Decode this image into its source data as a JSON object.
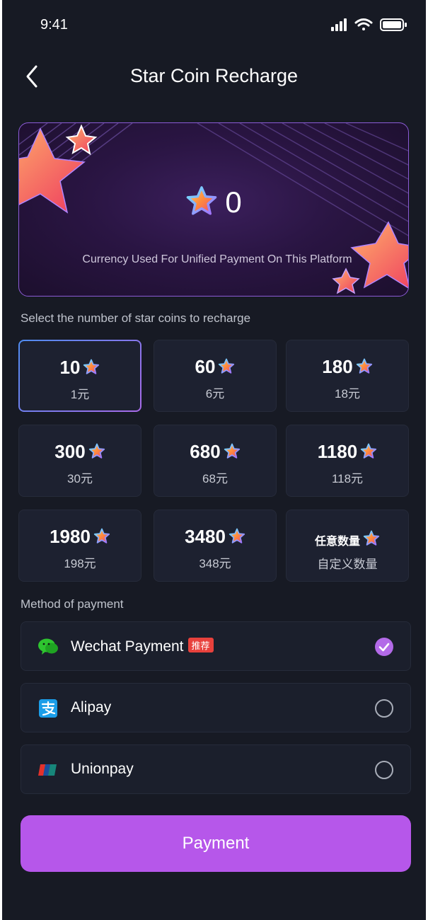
{
  "status_bar": {
    "time": "9:41"
  },
  "header": {
    "title": "Star Coin Recharge"
  },
  "banner": {
    "balance": "0",
    "description": "Currency Used For Unified Payment On This Platform"
  },
  "recharge": {
    "label": "Select the number of star coins to recharge",
    "options": [
      {
        "amount": "10",
        "price": "1元",
        "selected": true
      },
      {
        "amount": "60",
        "price": "6元"
      },
      {
        "amount": "180",
        "price": "18元"
      },
      {
        "amount": "300",
        "price": "30元"
      },
      {
        "amount": "680",
        "price": "68元"
      },
      {
        "amount": "1180",
        "price": "118元"
      },
      {
        "amount": "1980",
        "price": "198元"
      },
      {
        "amount": "3480",
        "price": "348元"
      },
      {
        "amount": "任意数量",
        "price": "自定义数量"
      }
    ]
  },
  "payment": {
    "label": "Method of payment",
    "methods": [
      {
        "name": "Wechat Payment",
        "tag": "推荐",
        "icon": "wechat-icon",
        "selected": true
      },
      {
        "name": "Alipay",
        "icon": "alipay-icon",
        "selected": false
      },
      {
        "name": "Unionpay",
        "icon": "unionpay-icon",
        "selected": false
      }
    ],
    "button_label": "Payment"
  },
  "colors": {
    "background": "#171a24",
    "accent": "#b657ea",
    "tag_red": "#e8413c"
  }
}
